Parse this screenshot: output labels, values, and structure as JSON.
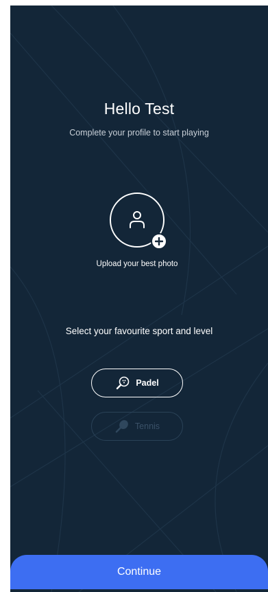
{
  "greeting": {
    "title": "Hello Test",
    "subtitle": "Complete your profile to start playing"
  },
  "photo": {
    "icon": "user-icon",
    "badge_icon": "plus-icon",
    "label": "Upload your best photo"
  },
  "sports": {
    "heading": "Select your favourite sport and level",
    "options": [
      {
        "label": "Padel",
        "icon": "padel-racket-icon",
        "state": "enabled"
      },
      {
        "label": "Tennis",
        "icon": "tennis-racket-icon",
        "state": "disabled"
      }
    ]
  },
  "footer": {
    "continue_label": "Continue"
  },
  "colors": {
    "background": "#132638",
    "accent": "#3d6ef2",
    "text": "#ffffff",
    "muted": "#c9d0d8"
  }
}
